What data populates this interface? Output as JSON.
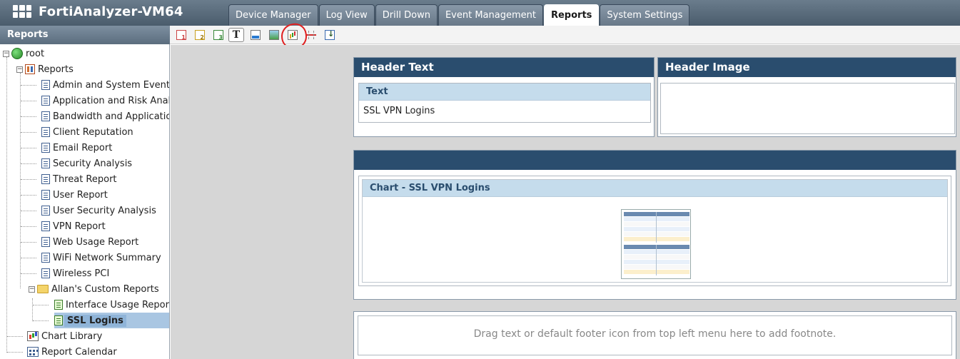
{
  "app": {
    "title": "FortiAnalyzer-VM64"
  },
  "tabs": [
    "Device Manager",
    "Log View",
    "Drill Down",
    "Event Management",
    "Reports",
    "System Settings"
  ],
  "active_tab": "Reports",
  "sidebar": {
    "header": "Reports",
    "root": "root",
    "reports_node": "Reports",
    "reports": [
      "Admin and System Events",
      "Application and Risk Analy",
      "Bandwidth and Application",
      "Client Reputation",
      "Email Report",
      "Security Analysis",
      "Threat Report",
      "User Report",
      "User Security Analysis",
      "VPN Report",
      "Web Usage Report",
      "WiFi Network Summary",
      "Wireless PCI"
    ],
    "custom_folder": "Allan's Custom Reports",
    "custom_reports": [
      "Interface Usage Repor",
      "SSL Logins"
    ],
    "selected": "SSL Logins",
    "chart_library": "Chart Library",
    "report_calendar": "Report Calendar"
  },
  "toolbar": {
    "icons": [
      "heading-1-icon",
      "heading-2-icon",
      "heading-3-icon",
      "text-icon",
      "section-icon",
      "image-icon",
      "chart-icon",
      "page-break-icon",
      "download-icon"
    ],
    "pressed": "text-icon",
    "annotated": "chart-icon"
  },
  "canvas": {
    "header_text_title": "Header Text",
    "header_image_title": "Header Image",
    "text_box_title": "Text",
    "text_box_value": "SSL VPN Logins",
    "chart_box_title": "Chart - SSL VPN Logins",
    "footer_hint": "Drag text or default footer icon from top left menu here to add footnote."
  },
  "colors": {
    "panel_header": "#2a4d6e",
    "inner_header": "#c5dcec",
    "annotation": "#e02020"
  }
}
